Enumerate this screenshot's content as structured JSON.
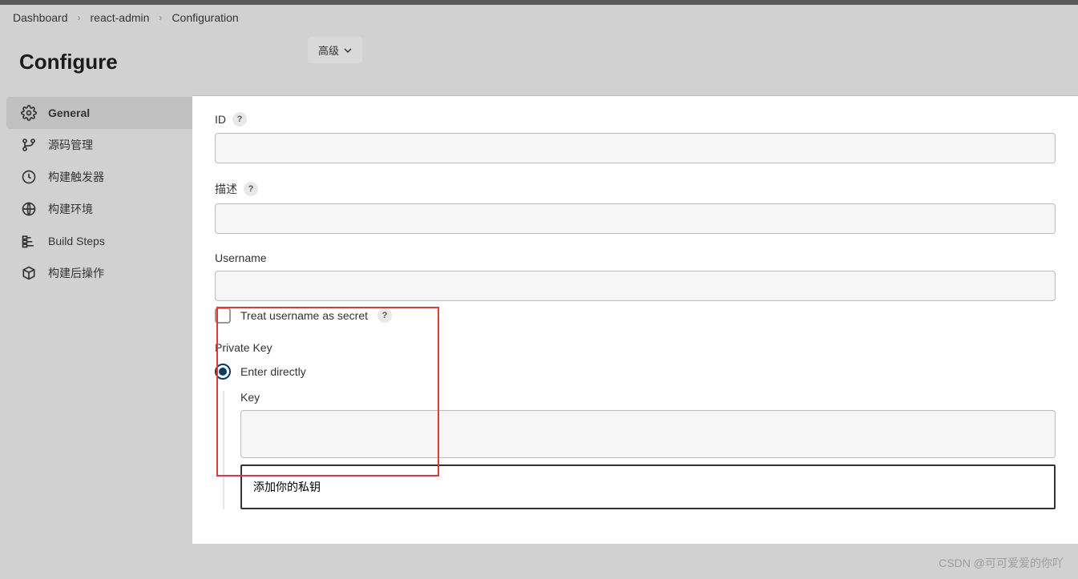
{
  "breadcrumb": [
    "Dashboard",
    "react-admin",
    "Configuration"
  ],
  "page_title": "Configure",
  "sidebar": {
    "items": [
      {
        "label": "General",
        "icon": "gear"
      },
      {
        "label": "源码管理",
        "icon": "branch"
      },
      {
        "label": "构建触发器",
        "icon": "clock"
      },
      {
        "label": "构建环境",
        "icon": "globe"
      },
      {
        "label": "Build Steps",
        "icon": "steps"
      },
      {
        "label": "构建后操作",
        "icon": "box"
      }
    ]
  },
  "advanced_button": "高级",
  "form": {
    "id_label": "ID",
    "desc_label": "描述",
    "username_label": "Username",
    "treat_secret_label": "Treat username as secret",
    "private_key_label": "Private Key",
    "enter_directly_label": "Enter directly",
    "key_label": "Key",
    "key_placeholder": "添加你的私钥"
  },
  "watermark": "CSDN @可可爱爱的你吖"
}
